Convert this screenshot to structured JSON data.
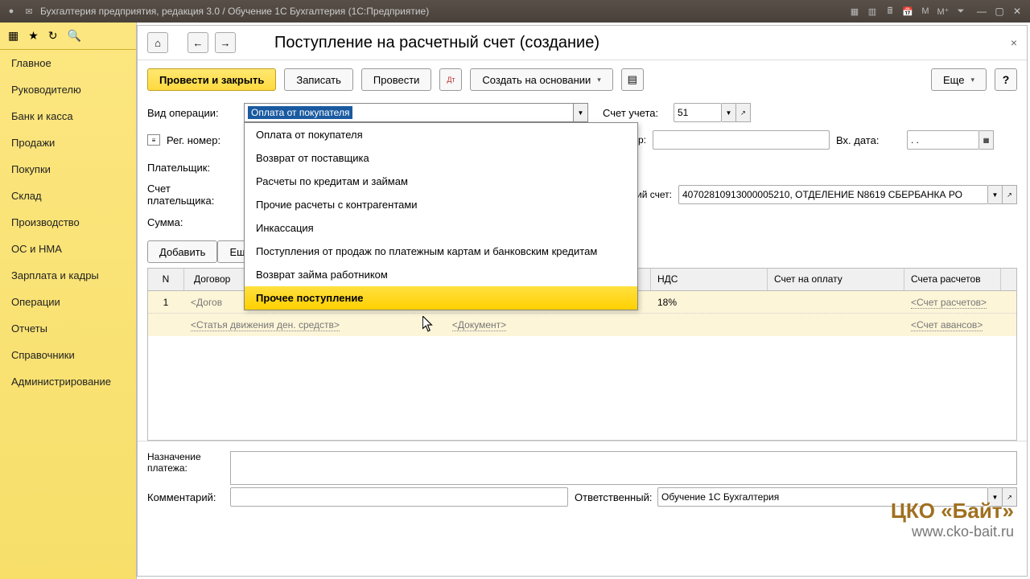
{
  "window_title": "Бухгалтерия предприятия, редакция 3.0 / Обучение 1С Бухгалтерия (1С:Предприятие)",
  "sidebar": {
    "items": [
      {
        "label": "Главное"
      },
      {
        "label": "Руководителю"
      },
      {
        "label": "Банк и касса"
      },
      {
        "label": "Продажи"
      },
      {
        "label": "Покупки"
      },
      {
        "label": "Склад"
      },
      {
        "label": "Производство"
      },
      {
        "label": "ОС и НМА"
      },
      {
        "label": "Зарплата и кадры"
      },
      {
        "label": "Операции"
      },
      {
        "label": "Отчеты"
      },
      {
        "label": "Справочники"
      },
      {
        "label": "Администрирование"
      }
    ]
  },
  "page": {
    "title": "Поступление на расчетный счет (создание)"
  },
  "toolbar": {
    "post_close": "Провести и закрыть",
    "save": "Записать",
    "post": "Провести",
    "based": "Создать на основании",
    "more": "Еще",
    "help": "?"
  },
  "form": {
    "op_type_lbl": "Вид операции:",
    "op_type_val": "Оплата от покупателя",
    "acct_lbl": "Счет учета:",
    "acct_val": "51",
    "reg_lbl": "Рег. номер:",
    "in_num_lbl": "Вх. номер:",
    "in_date_lbl": "Вх. дата:",
    "in_date_val": ". .",
    "payer_lbl": "Плательщик:",
    "payer_acct_lbl": "Счет плательщика:",
    "our_acct_lbl_suffix": "ий счет:",
    "our_acct_val": "40702810913000005210, ОТДЕЛЕНИЕ N8619 СБЕРБАНКА РО",
    "sum_lbl": "Сумма:",
    "add_btn": "Добавить",
    "more_btn": "Еще"
  },
  "dropdown": {
    "items": [
      "Оплата от покупателя",
      "Возврат от поставщика",
      "Расчеты по кредитам и займам",
      "Прочие расчеты с контрагентами",
      "Инкассация",
      "Поступления от продаж по платежным картам и банковским кредитам",
      "Возврат займа работником",
      "Прочее поступление"
    ]
  },
  "grid": {
    "head": {
      "n": "N",
      "c2": "Договор",
      "c3": "НДС",
      "c4": "Счет на оплату",
      "c5": "Счета расчетов"
    },
    "rows": [
      {
        "n": "1",
        "contract": "<Догов",
        "art": "<Статья движения ден. средств>",
        "doc": "<Документ>",
        "vat": "18%",
        "s1": "<Счет расчетов>",
        "s2": "<Счет авансов>"
      }
    ]
  },
  "bottom": {
    "purpose_lbl1": "Назначение",
    "purpose_lbl2": "платежа:",
    "comment_lbl": "Комментарий:",
    "resp_lbl": "Ответственный:",
    "resp_val": "Обучение 1С Бухгалтерия"
  },
  "watermark": {
    "l1": "ЦКО «Байт»",
    "l2": "www.cko-bait.ru"
  }
}
